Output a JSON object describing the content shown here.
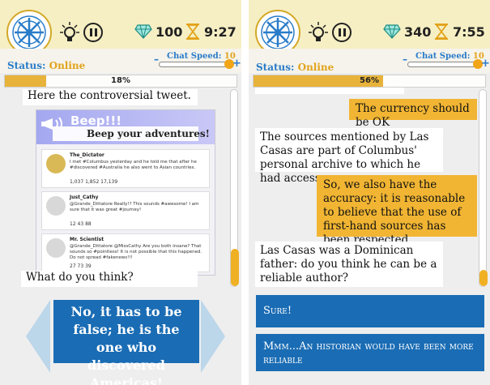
{
  "left": {
    "gems": "100",
    "time": "9:27",
    "status_label": "Status:",
    "status_value": "Online",
    "speed_label": "Chat Speed:",
    "speed_value": "10",
    "progress_text": "18%",
    "progress_fraction": 0.18,
    "msg1": "Here the controversial tweet.",
    "msg2": "What do you think?",
    "answer": "No, it has to be false; he is the one who discovered Americas!",
    "tweet": {
      "title": "Beep!!!",
      "subtitle": "Beep your adventures!",
      "posts": [
        {
          "name": "The_Dictator",
          "text": "I met #Columbus yesterday and he told me that after he #discovered #Australia he also went to Asian countries.",
          "stats": "1,037   1,852   17,139"
        },
        {
          "name": "Just_Cathy",
          "text": "@Grande_Dittatore Really!? This sounds #awesome! I am sure that it was great #journey!",
          "stats": "12   43   88"
        },
        {
          "name": "Mr. Scientist",
          "text": "@Grande_Dittatore @MissCathy Are you both insane? That sounds so #pointless! It is not possible that this happened. Do not spread #fakenews!!!",
          "stats": "27   73   39"
        }
      ]
    }
  },
  "right": {
    "gems": "340",
    "time": "7:55",
    "status_label": "Status:",
    "status_value": "Online",
    "speed_label": "Chat Speed:",
    "speed_value": "10",
    "progress_text": "56%",
    "progress_fraction": 0.56,
    "msg_currency": "The currency should be OK",
    "msg_sources": "The sources mentioned by Las Casas are part of Columbus' personal archive to which he had access.",
    "msg_accuracy": "So, we also have the accuracy: it is reasonable to believe that the use of first-hand sources has been respected.",
    "msg_question": "Las Casas was a Dominican father: do you think he can be a reliable author?",
    "choice1": "Sure!",
    "choice2": "Mmm...An historian would have been more reliable"
  },
  "colors": {
    "accent_blue": "#1a6cb4",
    "accent_orange": "#f1b533",
    "header_bg": "#f6efc3"
  }
}
